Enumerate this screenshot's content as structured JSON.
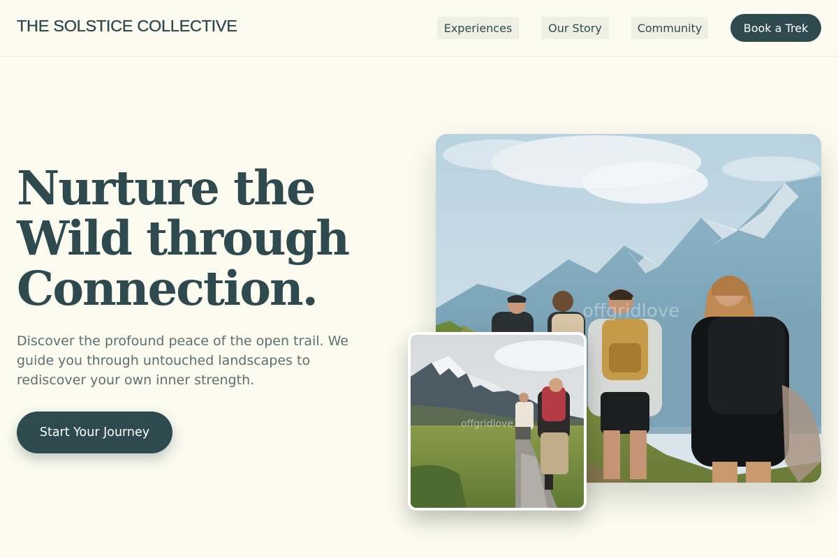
{
  "header": {
    "brand": "THE SOLSTICE COLLECTIVE",
    "nav": [
      {
        "label": "Experiences"
      },
      {
        "label": "Our Story"
      },
      {
        "label": "Community"
      }
    ],
    "cta_label": "Book a Trek"
  },
  "hero": {
    "title_lines": [
      "Nurture the",
      "Wild through",
      "Connection."
    ],
    "description_lines": [
      "Discover the profound peace of the open trail. We",
      "guide you through untouched landscapes to",
      "rediscover your own inner strength."
    ],
    "cta_label": "Start Your Journey"
  },
  "images": {
    "main": {
      "subject": "hikers walking toward snowy mountains",
      "watermark": "offgridlove"
    },
    "secondary": {
      "subject": "hikers on rocky trail below snowy peaks",
      "watermark": "offgridlove"
    }
  },
  "colors": {
    "background": "#fbfbef",
    "primary": "#2f4a4f",
    "nav_pill": "#eef0e4",
    "body_text": "#5e6f72"
  }
}
